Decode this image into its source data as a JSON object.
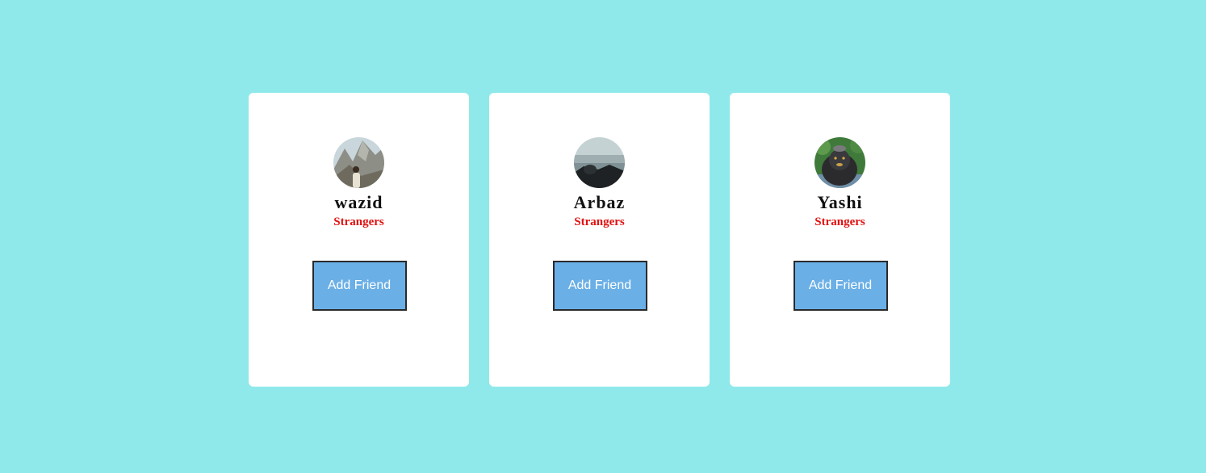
{
  "colors": {
    "background": "#8fe9ea",
    "card": "#ffffff",
    "status": "#e01010",
    "button": "#6aafe6"
  },
  "cards": [
    {
      "name": "wazid",
      "status": "Strangers",
      "button_label": "Add Friend",
      "avatar_icon": "mountain-photo-avatar"
    },
    {
      "name": "Arbaz",
      "status": "Strangers",
      "button_label": "Add Friend",
      "avatar_icon": "lake-landscape-avatar"
    },
    {
      "name": "Yashi",
      "status": "Strangers",
      "button_label": "Add Friend",
      "avatar_icon": "monkey-photo-avatar"
    }
  ]
}
